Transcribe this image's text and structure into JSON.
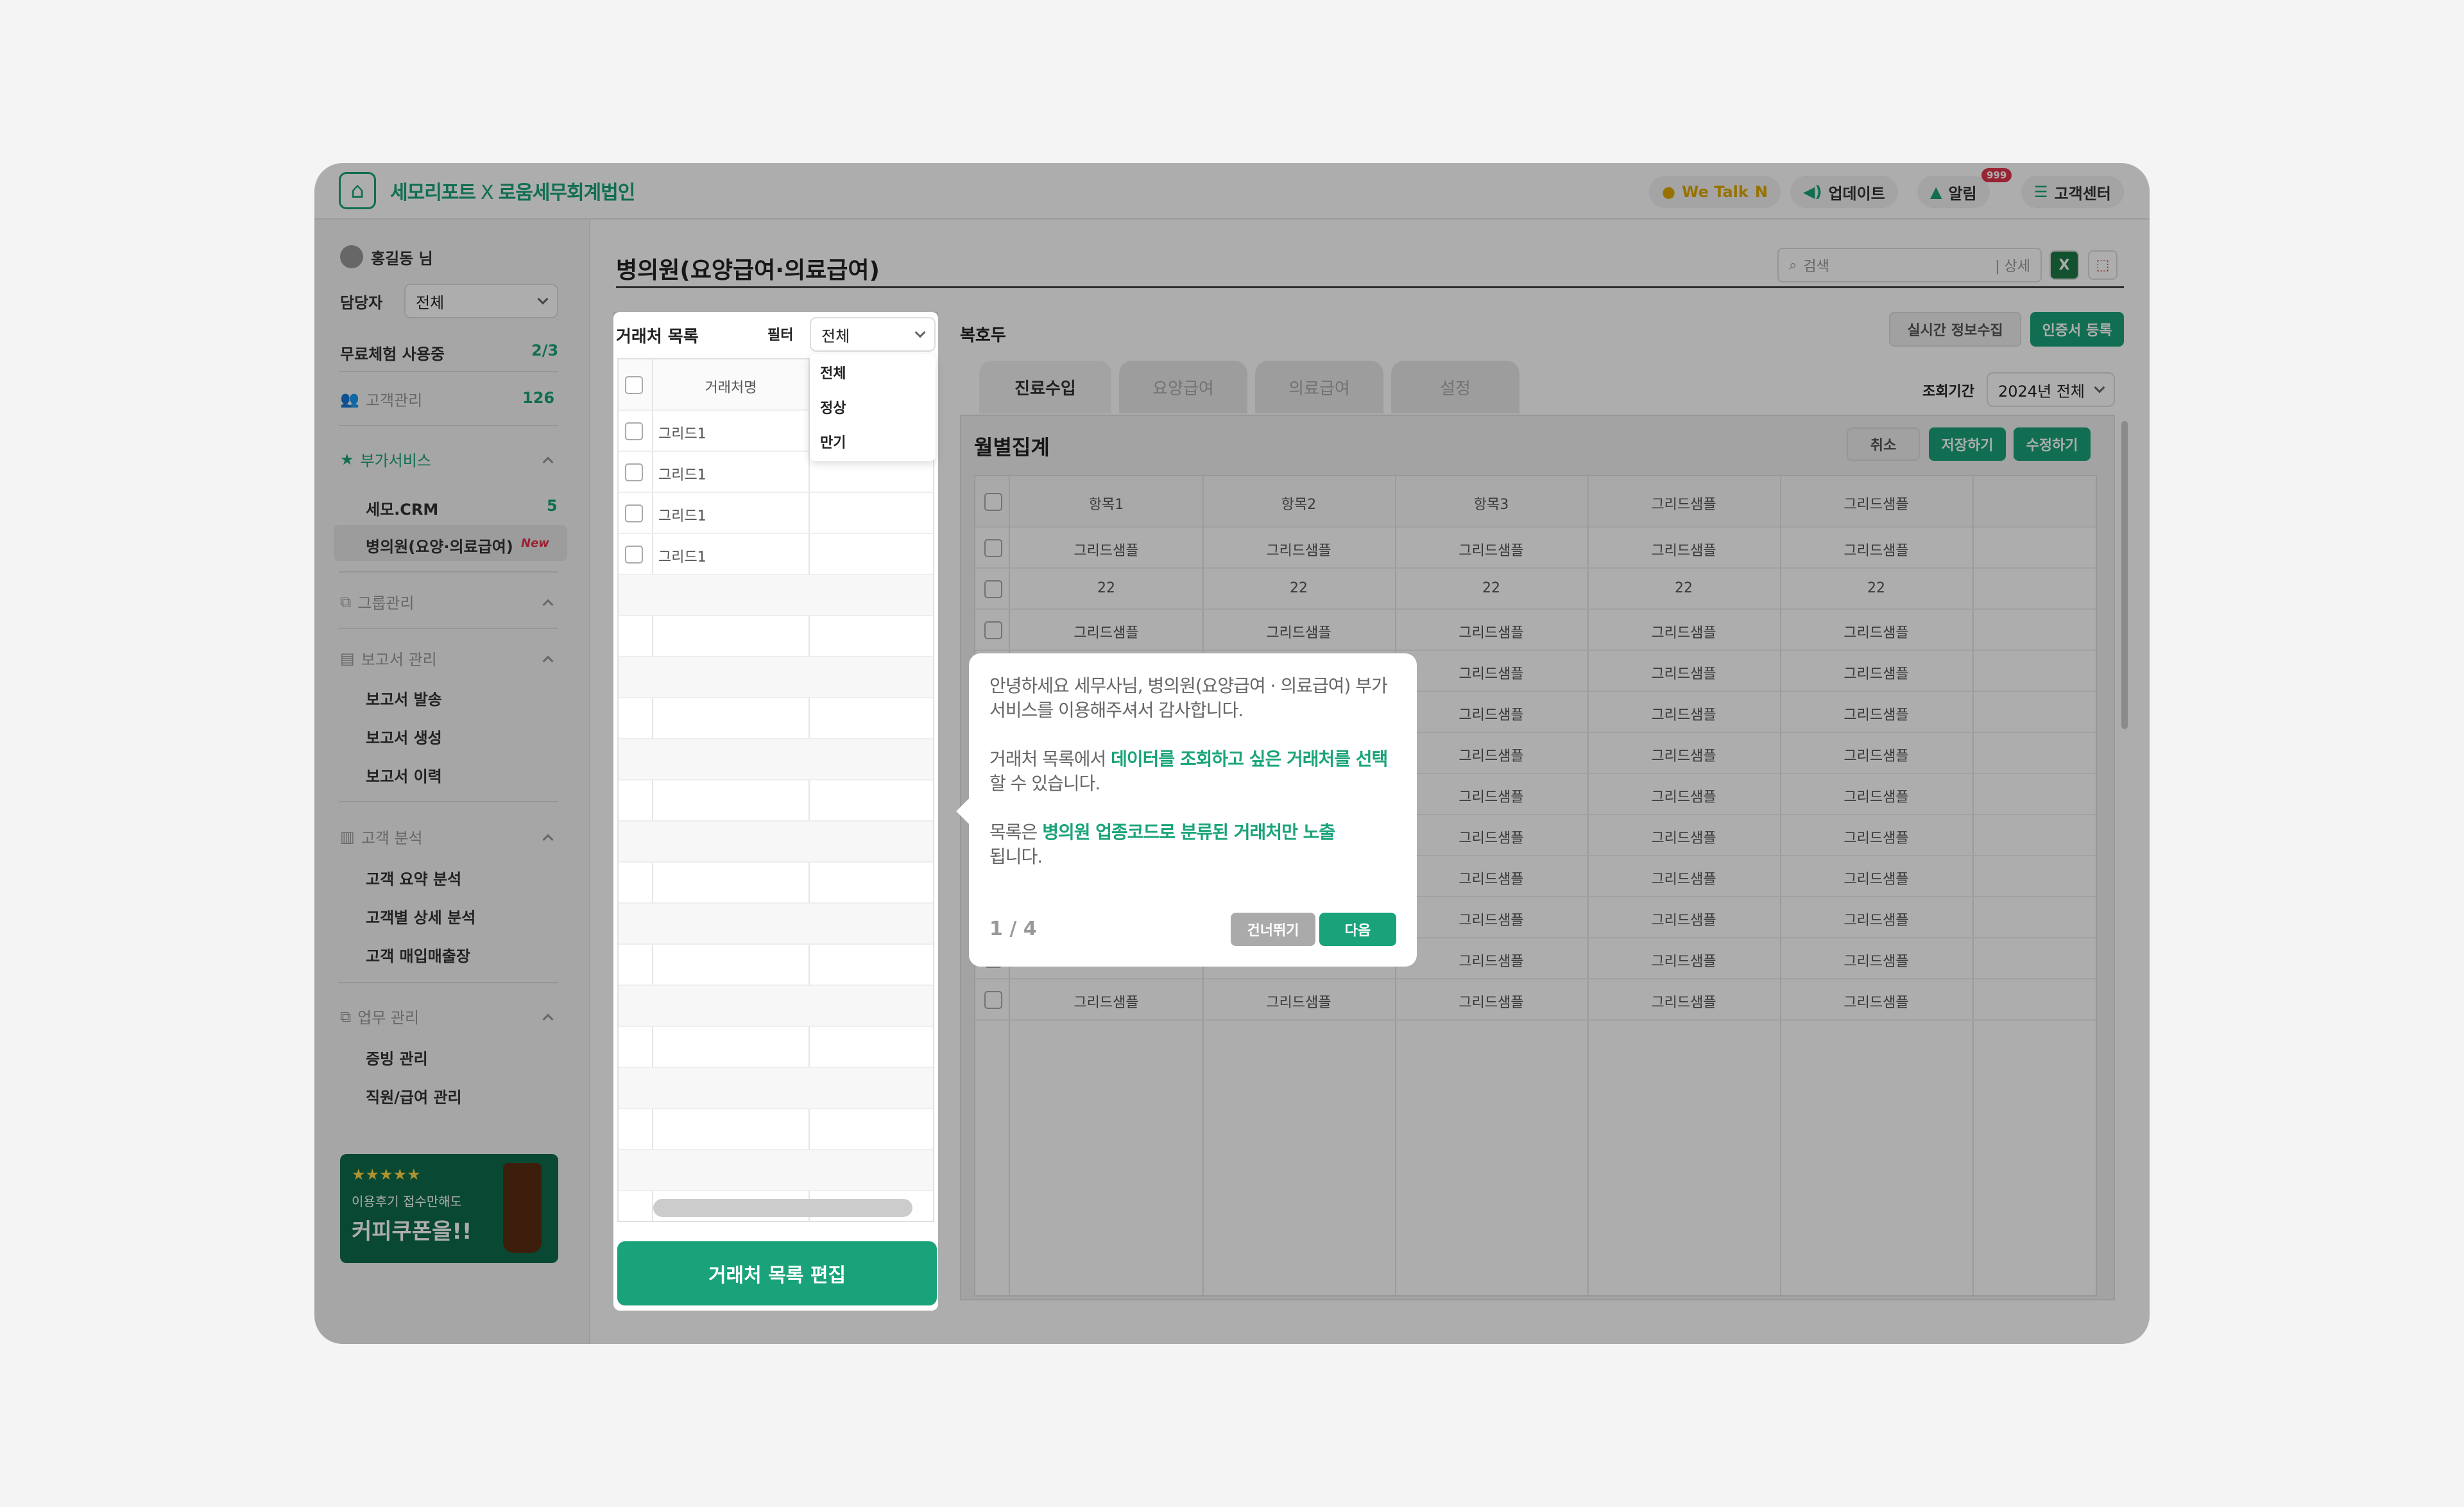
{
  "app": {
    "brand": "세모리포트",
    "brand_x": "X",
    "firm": "로움세무회계법인"
  },
  "topbar": {
    "wetalk": "We Talk",
    "wetalk_n": "N",
    "update": "업데이트",
    "alarm": "알림",
    "alarm_count": "999",
    "support": "고객센터"
  },
  "sidebar": {
    "user": "홍길동 님",
    "manager_label": "담당자",
    "manager_value": "전체",
    "trial_label": "무료체험 사용중",
    "trial_value": "2/3",
    "clients_label": "고객관리",
    "clients_count": "126",
    "addon_header": "부가서비스",
    "addon_items": [
      {
        "label": "세모.CRM",
        "count": "5"
      },
      {
        "label": "병의원(요양·의료급여)",
        "badge": "New"
      }
    ],
    "group_header": "그룹관리",
    "report_header": "보고서 관리",
    "report_items": [
      "보고서 발송",
      "보고서 생성",
      "보고서 이력"
    ],
    "analysis_header": "고객 분석",
    "analysis_items": [
      "고객 요약 분석",
      "고객별 상세 분석",
      "고객 매입매출장"
    ],
    "work_header": "업무 관리",
    "work_items": [
      "증빙 관리",
      "직원/급여 관리"
    ],
    "banner_stars": "★★★★★",
    "banner_line1": "이용후기 접수만해도",
    "banner_line2": "커피쿠폰을!!"
  },
  "main": {
    "title": "병의원(요양급여·의료급여)",
    "search_placeholder": "검색",
    "search_detail": "| 상세",
    "client_list": {
      "title": "거래처 목록",
      "filter_label": "필터",
      "filter_value": "전체",
      "filter_options": [
        "전체",
        "정상",
        "만기"
      ],
      "col_header": "거래처명",
      "rows": [
        "그리드1",
        "그리드1",
        "그리드1",
        "그리드1"
      ],
      "edit_button": "거래처 목록 편집"
    },
    "detail": {
      "client_name": "복호두",
      "realtime_button": "실시간 정보수집",
      "cert_button": "인증서 등록",
      "tabs": [
        "진료수입",
        "요양급여",
        "의료급여",
        "설정"
      ],
      "period_label": "조회기간",
      "period_value": "2024년 전체",
      "section_title": "월별집계",
      "cancel_button": "취소",
      "save_button": "저장하기",
      "edit_button": "수정하기",
      "columns": [
        "항목1",
        "항목2",
        "항목3",
        "그리드샘플",
        "그리드샘플"
      ],
      "rows": [
        [
          "그리드샘플",
          "그리드샘플",
          "그리드샘플",
          "그리드샘플",
          "그리드샘플"
        ],
        [
          "22",
          "22",
          "22",
          "22",
          "22"
        ],
        [
          "그리드샘플",
          "그리드샘플",
          "그리드샘플",
          "그리드샘플",
          "그리드샘플"
        ],
        [
          "",
          "",
          "그리드샘플",
          "그리드샘플",
          "그리드샘플"
        ],
        [
          "",
          "",
          "그리드샘플",
          "그리드샘플",
          "그리드샘플"
        ],
        [
          "",
          "",
          "그리드샘플",
          "그리드샘플",
          "그리드샘플"
        ],
        [
          "",
          "",
          "그리드샘플",
          "그리드샘플",
          "그리드샘플"
        ],
        [
          "",
          "",
          "그리드샘플",
          "그리드샘플",
          "그리드샘플"
        ],
        [
          "",
          "",
          "그리드샘플",
          "그리드샘플",
          "그리드샘플"
        ],
        [
          "",
          "",
          "그리드샘플",
          "그리드샘플",
          "그리드샘플"
        ],
        [
          "",
          "",
          "그리드샘플",
          "그리드샘플",
          "그리드샘플"
        ],
        [
          "그리드샘플",
          "그리드샘플",
          "그리드샘플",
          "그리드샘플",
          "그리드샘플"
        ]
      ]
    }
  },
  "tooltip": {
    "p1": "안녕하세요 세무사님, 병의원(요양급여 · 의료급여) 부가서비스를 이용해주셔서 감사합니다.",
    "p2_a": "거래처 목록에서 ",
    "p2_b": "데이터를 조회하고 싶은 거래처를 선택",
    "p2_c": "할 수 있습니다.",
    "p3_a": "목록은 ",
    "p3_b": "병의원 업종코드로 분류된 거래처만 노출",
    "p3_c": "됩니다.",
    "step": "1 / 4",
    "skip": "건너뛰기",
    "next": "다음"
  },
  "colors": {
    "accent": "#1aa37a",
    "badge": "#e0344a"
  }
}
